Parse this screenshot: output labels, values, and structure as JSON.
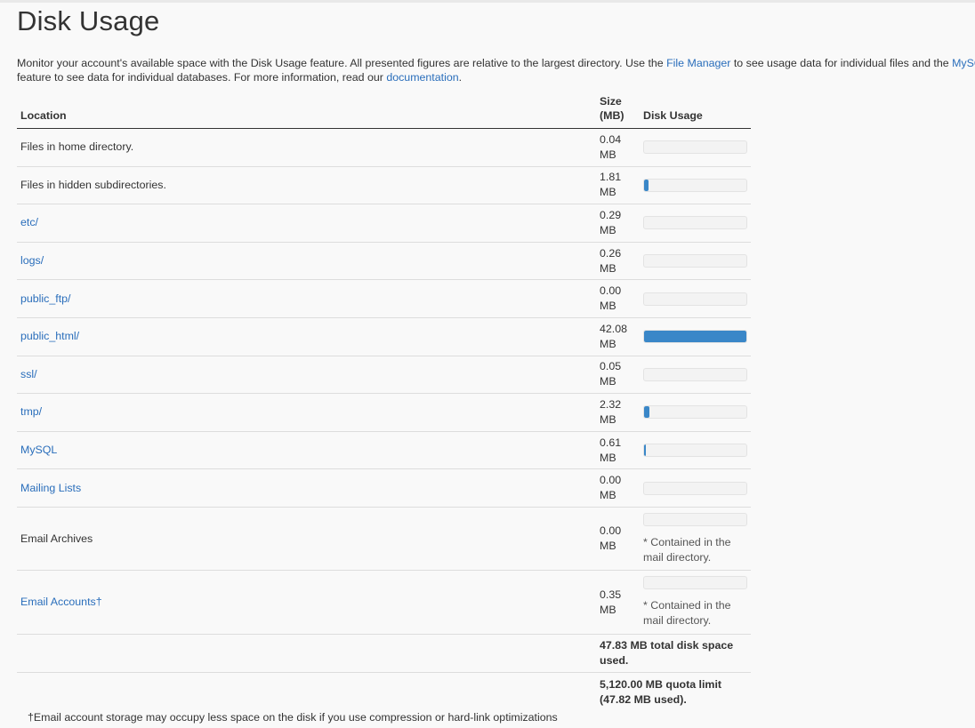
{
  "page": {
    "title": "Disk Usage",
    "intro": {
      "part1": "Monitor your account's available space with the Disk Usage feature. All presented figures are relative to the largest directory. Use the ",
      "file_manager_link": "File Manager",
      "part2": " to see usage data for individual files and the ",
      "mysql_link": "MySQL",
      "part3": "feature to see data for individual databases. For more information, read our ",
      "documentation_link": "documentation",
      "part4": "."
    }
  },
  "table": {
    "headers": {
      "location": "Location",
      "size": "Size (MB)",
      "disk_usage": "Disk Usage"
    },
    "rows": [
      {
        "location": "Files in home directory.",
        "link": false,
        "size": "0.04 MB",
        "usage_fraction": 0.0
      },
      {
        "location": "Files in hidden subdirectories.",
        "link": false,
        "size": "1.81 MB",
        "usage_fraction": 0.043
      },
      {
        "location": "etc/",
        "link": true,
        "size": "0.29 MB",
        "usage_fraction": 0.0
      },
      {
        "location": "logs/",
        "link": true,
        "size": "0.26 MB",
        "usage_fraction": 0.0
      },
      {
        "location": "public_ftp/",
        "link": true,
        "size": "0.00 MB",
        "usage_fraction": 0.0
      },
      {
        "location": "public_html/",
        "link": true,
        "size": "42.08 MB",
        "usage_fraction": 1.0
      },
      {
        "location": "ssl/",
        "link": true,
        "size": "0.05 MB",
        "usage_fraction": 0.0
      },
      {
        "location": "tmp/",
        "link": true,
        "size": "2.32 MB",
        "usage_fraction": 0.055
      },
      {
        "location": "MySQL",
        "link": true,
        "size": "0.61 MB",
        "usage_fraction": 0.015
      },
      {
        "location": "Mailing Lists",
        "link": true,
        "size": "0.00 MB",
        "usage_fraction": 0.0
      },
      {
        "location": "Email Archives",
        "link": false,
        "size": "0.00 MB",
        "usage_fraction": 0.0,
        "note": "* Contained in the mail directory."
      },
      {
        "location": "Email Accounts†",
        "link": true,
        "size": "0.35 MB",
        "usage_fraction": 0.0,
        "note": "* Contained in the mail directory."
      }
    ],
    "total_used": "47.83 MB total disk space used.",
    "quota": "5,120.00 MB quota limit (47.82 MB used)."
  },
  "footnote": "†Email account storage may occupy less space on the disk if you use compression or hard-link optimizations"
}
